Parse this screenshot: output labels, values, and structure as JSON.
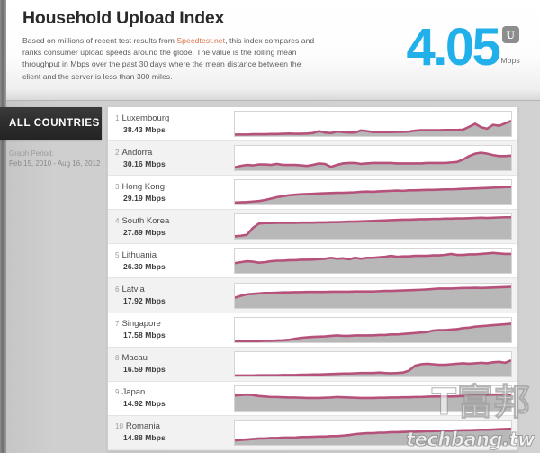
{
  "header": {
    "title": "Household Upload Index",
    "description_part1": "Based on millions of recent test results from ",
    "description_link": "Speedtest.net",
    "description_part2": ", this index compares and ranks consumer upload speeds around the globe. The value is the rolling mean throughput in Mbps over the past 30 days where the mean distance between the client and the server is less than 300 miles.",
    "big_value": "4.05",
    "badge_letter": "U",
    "unit": "Mbps",
    "accent_color": "#22b0ea",
    "link_color": "#d8714a"
  },
  "sidebar": {
    "filter_label": "ALL COUNTRIES",
    "graph_period_label": "Graph Period:",
    "graph_period_range": "Feb 15, 2010 - Aug 16, 2012"
  },
  "watermark": {
    "cn_text": "T富邦",
    "domain": "techbang.tw"
  },
  "chart_data": {
    "type": "line",
    "title": "Household Upload Index",
    "xlabel": "Feb 15, 2010 - Aug 16, 2012",
    "ylabel": "Mbps",
    "fill_color": "#b8b8b8",
    "line_color": "#b5517a",
    "categories": [
      "Luxembourg",
      "Andorra",
      "Hong Kong",
      "South Korea",
      "Lithuania",
      "Latvia",
      "Singapore",
      "Macau",
      "Japan",
      "Romania"
    ],
    "values": [
      38.43,
      30.16,
      29.19,
      27.89,
      26.3,
      17.92,
      17.58,
      16.59,
      14.92,
      14.88
    ],
    "unit": "Mbps",
    "series": [
      {
        "name": "Luxembourg",
        "rank": "1",
        "value": "38.43 Mbps",
        "trend": [
          6,
          6,
          6,
          7,
          7,
          7,
          8,
          8,
          9,
          10,
          9,
          9,
          10,
          12,
          20,
          14,
          12,
          18,
          16,
          14,
          14,
          23,
          20,
          16,
          16,
          16,
          16,
          17,
          17,
          18,
          22,
          24,
          24,
          24,
          24,
          25,
          25,
          25,
          26,
          38,
          50,
          36,
          30,
          46,
          42,
          52,
          62
        ]
      },
      {
        "name": "Andorra",
        "rank": "2",
        "value": "30.16 Mbps",
        "trend": [
          12,
          18,
          22,
          20,
          24,
          24,
          22,
          26,
          22,
          22,
          22,
          20,
          18,
          22,
          28,
          26,
          14,
          22,
          28,
          30,
          30,
          26,
          28,
          30,
          30,
          30,
          30,
          28,
          28,
          28,
          28,
          28,
          30,
          30,
          30,
          30,
          32,
          34,
          44,
          58,
          68,
          72,
          68,
          62,
          58,
          58,
          60
        ]
      },
      {
        "name": "Hong Kong",
        "rank": "3",
        "value": "29.19 Mbps",
        "trend": [
          8,
          9,
          10,
          12,
          14,
          18,
          24,
          30,
          34,
          38,
          40,
          42,
          43,
          44,
          45,
          46,
          47,
          48,
          48,
          49,
          50,
          52,
          53,
          52,
          54,
          55,
          56,
          57,
          56,
          58,
          58,
          59,
          60,
          60,
          61,
          62,
          62,
          63,
          64,
          65,
          66,
          67,
          68,
          69,
          70,
          71,
          72
        ]
      },
      {
        "name": "South Korea",
        "rank": "4",
        "value": "27.89 Mbps",
        "trend": [
          10,
          12,
          16,
          44,
          62,
          64,
          64,
          65,
          65,
          65,
          65,
          66,
          66,
          66,
          67,
          67,
          68,
          68,
          69,
          70,
          70,
          71,
          72,
          73,
          74,
          75,
          76,
          77,
          78,
          78,
          79,
          80,
          80,
          81,
          81,
          82,
          82,
          83,
          83,
          84,
          85,
          86,
          85,
          86,
          87,
          88,
          88
        ]
      },
      {
        "name": "Lithuania",
        "rank": "5",
        "value": "26.30 Mbps",
        "trend": [
          40,
          44,
          48,
          46,
          42,
          44,
          48,
          50,
          50,
          52,
          52,
          54,
          54,
          55,
          56,
          58,
          62,
          58,
          60,
          56,
          62,
          58,
          62,
          62,
          64,
          66,
          70,
          66,
          68,
          68,
          70,
          70,
          70,
          72,
          72,
          74,
          78,
          74,
          74,
          76,
          76,
          78,
          80,
          82,
          80,
          78,
          78
        ]
      },
      {
        "name": "Latvia",
        "rank": "6",
        "value": "17.92 Mbps",
        "trend": [
          42,
          50,
          56,
          58,
          60,
          62,
          62,
          63,
          64,
          64,
          65,
          65,
          66,
          66,
          66,
          66,
          67,
          67,
          67,
          67,
          68,
          68,
          68,
          68,
          69,
          70,
          70,
          71,
          72,
          73,
          74,
          75,
          76,
          78,
          80,
          80,
          80,
          81,
          82,
          82,
          83,
          82,
          83,
          84,
          85,
          86,
          87
        ]
      },
      {
        "name": "Singapore",
        "rank": "7",
        "value": "17.58 Mbps",
        "trend": [
          4,
          4,
          5,
          5,
          5,
          6,
          6,
          7,
          8,
          10,
          14,
          18,
          20,
          22,
          23,
          24,
          26,
          28,
          26,
          26,
          28,
          28,
          28,
          28,
          30,
          30,
          32,
          32,
          34,
          36,
          38,
          40,
          42,
          48,
          50,
          50,
          52,
          54,
          58,
          60,
          64,
          66,
          68,
          70,
          72,
          74,
          76
        ]
      },
      {
        "name": "Macau",
        "rank": "8",
        "value": "16.59 Mbps",
        "trend": [
          4,
          4,
          4,
          4,
          5,
          5,
          5,
          5,
          6,
          6,
          6,
          7,
          7,
          8,
          8,
          9,
          10,
          11,
          12,
          12,
          13,
          14,
          14,
          14,
          16,
          14,
          13,
          14,
          16,
          24,
          44,
          50,
          52,
          50,
          48,
          48,
          50,
          52,
          54,
          52,
          54,
          56,
          54,
          58,
          60,
          56,
          66
        ]
      },
      {
        "name": "Japan",
        "rank": "9",
        "value": "14.92 Mbps",
        "trend": [
          62,
          64,
          66,
          64,
          60,
          58,
          56,
          56,
          55,
          54,
          54,
          53,
          52,
          52,
          52,
          53,
          54,
          56,
          55,
          54,
          53,
          52,
          52,
          52,
          53,
          53,
          54,
          54,
          55,
          55,
          56,
          56,
          57,
          58,
          58,
          58,
          58,
          59,
          60,
          62,
          64,
          64,
          65,
          66,
          66,
          66,
          66
        ]
      },
      {
        "name": "Romania",
        "rank": "10",
        "value": "14.88 Mbps",
        "trend": [
          18,
          20,
          22,
          24,
          26,
          26,
          28,
          28,
          30,
          30,
          30,
          32,
          32,
          33,
          34,
          34,
          36,
          36,
          38,
          40,
          44,
          46,
          48,
          48,
          50,
          50,
          52,
          52,
          53,
          54,
          54,
          55,
          56,
          56,
          57,
          58,
          58,
          59,
          60,
          60,
          61,
          62,
          62,
          63,
          64,
          65,
          66
        ]
      }
    ]
  }
}
